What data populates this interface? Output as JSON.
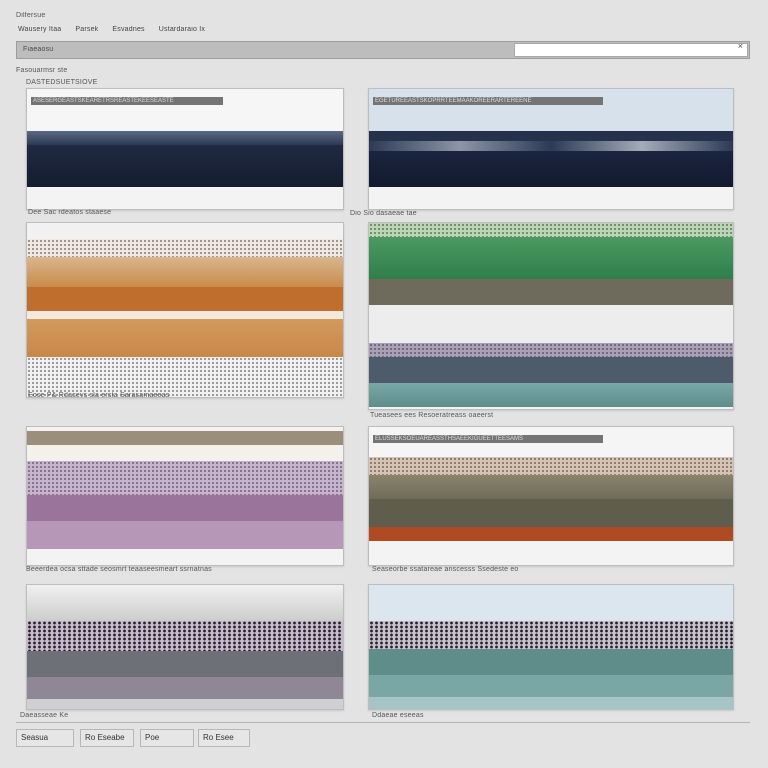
{
  "window": {
    "title": "Dilfersue",
    "menu": [
      "Wausery Itaa",
      "Parsek",
      "Esvadnes",
      "Ustardaraio Ix"
    ]
  },
  "toolbar": {
    "label": "Fiaeaosu",
    "search_value": "",
    "close_glyph": "×"
  },
  "sections": {
    "heading_small": "Fasouarmsr ste",
    "heading": "DASTEDSUETSIOVE"
  },
  "panels": [
    {
      "title": "ASESERGEASTSKEARETRSREASTEKEESEASTE",
      "caption": "Dee Sac rdeatos staaese"
    },
    {
      "title": "EGETUREEASTSKOPRRTEEMAAKOREERARTEREENE",
      "caption": "Dio Sio dasaeae tae"
    },
    {
      "title": "",
      "caption": "Eose P& Rdasevs sla ersta Sarasamaeeas"
    },
    {
      "title": "",
      "caption": "Tueasees ees   Resoeratreass oaeerst"
    },
    {
      "title": "",
      "caption": "Beeerdea ocsa sttade seosmrt teaaseesmeart ssrnatnas"
    },
    {
      "title": "ELUSSEKSOEUAREASSTHSAEEKIGUEETTEESAMS",
      "caption": "Seaseorbe ssatareae anscesss    Ssedeste eo"
    },
    {
      "title": "",
      "caption": "Daeasseae Ke"
    },
    {
      "title": "",
      "caption": "Ddaeae eseeas"
    }
  ],
  "footer": {
    "buttons": [
      "Seasua",
      "Ro Eseabe",
      "Poe",
      "Ro Esee"
    ]
  },
  "colors": {
    "background": "#e3e3e3",
    "navy": "#1f2a42",
    "ochre": "#c98b4c",
    "forest": "#2f7d49",
    "mauve": "#9a749b",
    "olive": "#5f5e4c",
    "rust": "#b04a23",
    "teal": "#5f8d8a"
  }
}
